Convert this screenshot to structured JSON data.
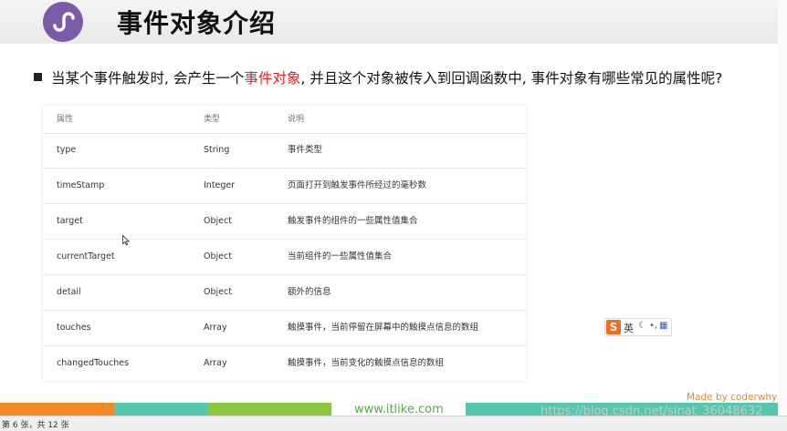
{
  "slide": {
    "title": "事件对象介绍",
    "question_before": "当某个事件触发时, 会产生一个",
    "question_highlight": "事件对象",
    "question_after": ", 并且这个对象被传入到回调函数中, 事件对象有哪些常见的属性呢?"
  },
  "table": {
    "headers": [
      "属性",
      "类型",
      "说明"
    ],
    "rows": [
      [
        "type",
        "String",
        "事件类型"
      ],
      [
        "timeStamp",
        "Integer",
        "页面打开到触发事件所经过的毫秒数"
      ],
      [
        "target",
        "Object",
        "触发事件的组件的一些属性值集合"
      ],
      [
        "currentTarget",
        "Object",
        "当前组件的一些属性值集合"
      ],
      [
        "detail",
        "Object",
        "额外的信息"
      ],
      [
        "touches",
        "Array",
        "触摸事件，当前停留在屏幕中的触摸点信息的数组"
      ],
      [
        "changedTouches",
        "Array",
        "触摸事件，当前变化的触摸点信息的数组"
      ]
    ]
  },
  "ime": {
    "logo": "S",
    "lang": "英",
    "icons": [
      "moon-icon",
      "punctuation-icon",
      "grid-icon"
    ]
  },
  "footer": {
    "site": "www.itlike.com",
    "watermark": "https://blog.csdn.net/sinat_36048632",
    "made_by": "Made by coderwhy"
  },
  "status": {
    "page_info": "第 6 张，共 12 张"
  },
  "colors": {
    "accent_red": "#e4242b",
    "logo_purple": "#7b5aa6",
    "orange": "#f08a24",
    "teal": "#55c7b0",
    "green": "#8dc63f"
  }
}
